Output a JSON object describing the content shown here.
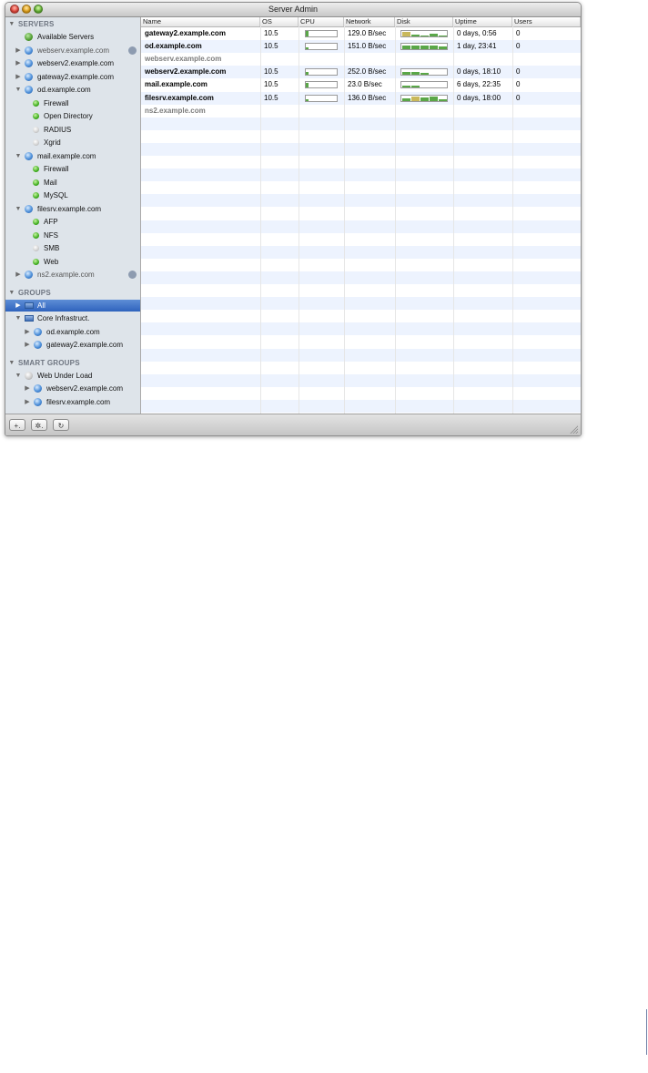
{
  "window": {
    "title": "Server Admin"
  },
  "sidebar": {
    "items": [
      {
        "type": "header",
        "label": "SERVERS",
        "tri": "▼",
        "indent": 0
      },
      {
        "type": "globe",
        "label": "Available Servers",
        "indent": 1
      },
      {
        "type": "server",
        "label": "webserv.example.com",
        "tri": "▶",
        "indent": 1,
        "dim": true,
        "badge": true
      },
      {
        "type": "server",
        "label": "webserv2.example.com",
        "tri": "▶",
        "indent": 1
      },
      {
        "type": "server",
        "label": "gateway2.example.com",
        "tri": "▶",
        "indent": 1
      },
      {
        "type": "server",
        "label": "od.example.com",
        "tri": "▼",
        "indent": 1
      },
      {
        "type": "service",
        "label": "Firewall",
        "indent": 2
      },
      {
        "type": "service",
        "label": "Open Directory",
        "indent": 2
      },
      {
        "type": "service",
        "label": "RADIUS",
        "indent": 2,
        "gray": true
      },
      {
        "type": "service",
        "label": "Xgrid",
        "indent": 2,
        "gray": true
      },
      {
        "type": "server",
        "label": "mail.example.com",
        "tri": "▼",
        "indent": 1
      },
      {
        "type": "service",
        "label": "Firewall",
        "indent": 2
      },
      {
        "type": "service",
        "label": "Mail",
        "indent": 2
      },
      {
        "type": "service",
        "label": "MySQL",
        "indent": 2
      },
      {
        "type": "server",
        "label": "filesrv.example.com",
        "tri": "▼",
        "indent": 1
      },
      {
        "type": "service",
        "label": "AFP",
        "indent": 2
      },
      {
        "type": "service",
        "label": "NFS",
        "indent": 2
      },
      {
        "type": "service",
        "label": "SMB",
        "indent": 2,
        "gray": true
      },
      {
        "type": "service",
        "label": "Web",
        "indent": 2
      },
      {
        "type": "server",
        "label": "ns2.example.com",
        "tri": "▶",
        "indent": 1,
        "dim": true,
        "badge": true
      },
      {
        "type": "spacer"
      },
      {
        "type": "header",
        "label": "GROUPS",
        "tri": "▼",
        "indent": 0
      },
      {
        "type": "group",
        "label": "All",
        "tri": "▶",
        "indent": 1,
        "selected": true
      },
      {
        "type": "group",
        "label": "Core Infrastruct.",
        "tri": "▼",
        "indent": 1
      },
      {
        "type": "server",
        "label": "od.example.com",
        "tri": "▶",
        "indent": 2
      },
      {
        "type": "server",
        "label": "gateway2.example.com",
        "tri": "▶",
        "indent": 2
      },
      {
        "type": "spacer"
      },
      {
        "type": "header",
        "label": "SMART GROUPS",
        "tri": "▼",
        "indent": 0
      },
      {
        "type": "smart",
        "label": "Web Under Load",
        "tri": "▼",
        "indent": 1
      },
      {
        "type": "server",
        "label": "webserv2.example.com",
        "tri": "▶",
        "indent": 2
      },
      {
        "type": "server",
        "label": "filesrv.example.com",
        "tri": "▶",
        "indent": 2
      }
    ]
  },
  "table": {
    "columns": [
      "Name",
      "OS",
      "CPU",
      "Network",
      "Disk",
      "Uptime",
      "Users"
    ],
    "rows": [
      {
        "name": "gateway2.example.com",
        "os": "10.5",
        "cpu": 0.1,
        "network": "129.0 B/sec",
        "disk": [
          0.8,
          0.4,
          0.2,
          0.5,
          0.2
        ],
        "uptime": "0 days, 0:56",
        "users": "0"
      },
      {
        "name": "od.example.com",
        "os": "10.5",
        "cpu": 0.02,
        "network": "151.0 B/sec",
        "disk": [
          0.6,
          0.6,
          0.7,
          0.7,
          0.5
        ],
        "uptime": "1 day, 23:41",
        "users": "0"
      },
      {
        "name": "webserv.example.com",
        "offline": true
      },
      {
        "name": "webserv2.example.com",
        "os": "10.5",
        "cpu": 0.05,
        "network": "252.0 B/sec",
        "disk": [
          0.5,
          0.5,
          0.4,
          0,
          0
        ],
        "uptime": "0 days, 18:10",
        "users": "0"
      },
      {
        "name": "mail.example.com",
        "os": "10.5",
        "cpu": 0.08,
        "network": "23.0 B/sec",
        "disk": [
          0.3,
          0.3,
          0,
          0,
          0
        ],
        "uptime": "6 days, 22:35",
        "users": "0"
      },
      {
        "name": "filesrv.example.com",
        "os": "10.5",
        "cpu": 0.03,
        "network": "136.0 B/sec",
        "disk": [
          0.5,
          0.9,
          0.6,
          0.8,
          0.4
        ],
        "uptime": "0 days, 18:00",
        "users": "0"
      },
      {
        "name": "ns2.example.com",
        "offline": true
      }
    ]
  },
  "bottombar": {
    "add_label": "+.",
    "action_label": "✲.",
    "refresh_label": "↻"
  },
  "colors": {
    "selection": "#3a6fc4",
    "sidebar_bg": "#dee4ea",
    "stripe": "#edf3fe",
    "meter_green": "#5aa748",
    "disk_yellow": "#c9b85a"
  }
}
